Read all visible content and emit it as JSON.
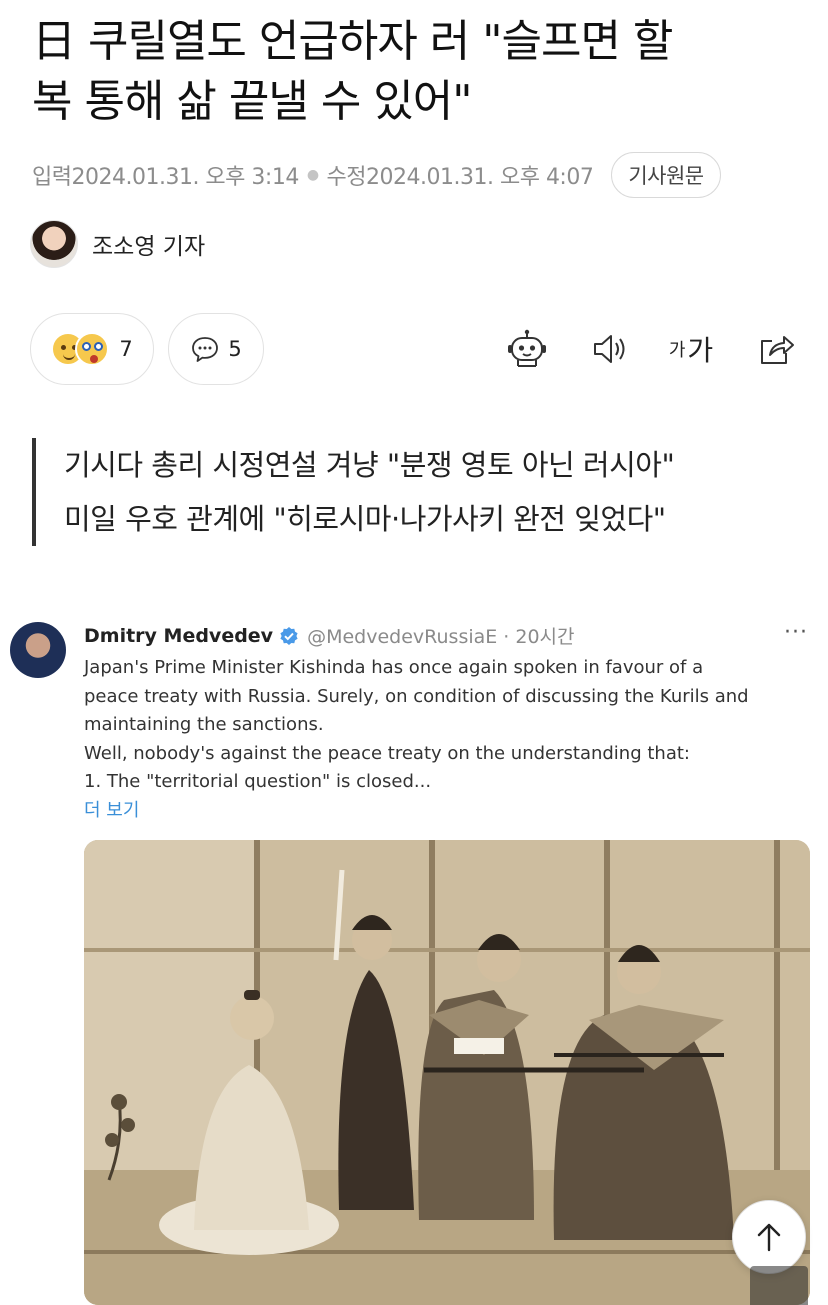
{
  "article": {
    "headline_line1": "日 쿠릴열도 언급하자 러 \"슬프면 할",
    "headline_line2": "복 통해 삶 끝낼 수 있어\"",
    "input_label": "입력",
    "input_time": "2024.01.31. 오후 3:14",
    "modified_label": "수정",
    "modified_time": "2024.01.31. 오후 4:07",
    "original_button": "기사원문",
    "author": "조소영 기자",
    "reaction_count": "7",
    "comment_count": "5",
    "font_size_small": "가",
    "font_size_large": "가",
    "subhead_line1": "기시다 총리 시정연설 겨냥 \"분쟁 영토 아닌 러시아\"",
    "subhead_line2": "미일 우호 관계에 \"히로시마·나가사키 완전 잊었다\""
  },
  "tweet": {
    "name": "Dmitry Medvedev",
    "handle": "@MedvedevRussiaE · 20시간",
    "more": "···",
    "lines": [
      "Japan's Prime Minister Kishinda has once again spoken in favour of a",
      "peace treaty with Russia. Surely, on condition of discussing the Kurils and",
      "maintaining the sanctions.",
      "Well, nobody's against the peace treaty on the understanding that:",
      "1. The \"territorial question\" is closed..."
    ],
    "see_more": "더 보기"
  },
  "colors": {
    "text": "#111111",
    "meta": "#8c8c8c",
    "link": "#3a8fd8",
    "verified": "#4a9ae8",
    "photo_sepia": "#c4b394"
  },
  "icons": [
    "emoji-smile-icon",
    "emoji-surprised-icon",
    "comment-icon",
    "robot-icon",
    "speaker-icon",
    "font-size-icon",
    "share-icon",
    "verified-badge-icon",
    "arrow-up-icon"
  ]
}
